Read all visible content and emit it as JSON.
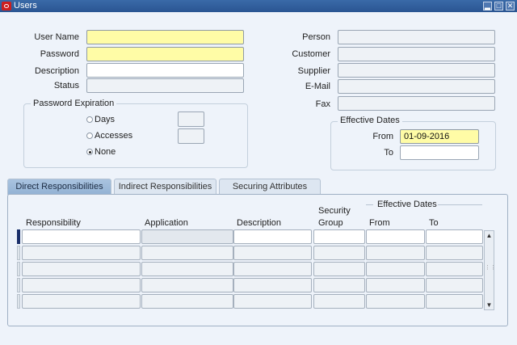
{
  "window": {
    "title": "Users",
    "buttons": {
      "minimize": "▂",
      "maximize": "□",
      "close": "✕"
    }
  },
  "form": {
    "user_name_label": "User Name",
    "user_name_value": "",
    "password_label": "Password",
    "password_value": "",
    "description_label": "Description",
    "description_value": "",
    "status_label": "Status",
    "status_value": "",
    "person_label": "Person",
    "customer_label": "Customer",
    "supplier_label": "Supplier",
    "email_label": "E-Mail",
    "fax_label": "Fax"
  },
  "password_expiration": {
    "title": "Password Expiration",
    "options": [
      {
        "label": "Days",
        "selected": false
      },
      {
        "label": "Accesses",
        "selected": false
      },
      {
        "label": "None",
        "selected": true
      }
    ]
  },
  "effective_dates": {
    "title": "Effective Dates",
    "from_label": "From",
    "from_value": "01-09-2016",
    "to_label": "To",
    "to_value": ""
  },
  "tabs": [
    {
      "label": "Direct Responsibilities",
      "active": true
    },
    {
      "label": "Indirect Responsibilities",
      "active": false
    },
    {
      "label": "Securing Attributes",
      "active": false
    }
  ],
  "grid": {
    "effective_dates_header": "Effective Dates",
    "columns": {
      "responsibility": "Responsibility",
      "application": "Application",
      "description": "Description",
      "security_line1": "Security",
      "security_line2": "Group",
      "from": "From",
      "to": "To"
    },
    "rows": 5
  },
  "colors": {
    "titlebar": "#2a5592",
    "required_field": "#fffca6",
    "active_tab": "#93b2d4",
    "row_indicator": "#1a2f6a"
  }
}
